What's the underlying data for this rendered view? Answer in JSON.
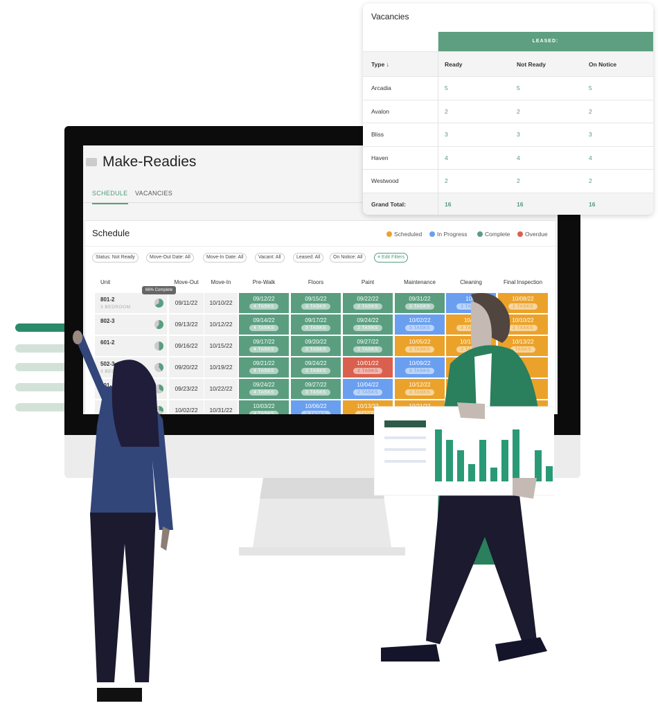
{
  "app": {
    "title": "Make-Readies",
    "tabs": [
      "SCHEDULE",
      "VACANCIES"
    ],
    "active_tab": "SCHEDULE"
  },
  "schedule": {
    "title": "Schedule",
    "legend": [
      {
        "label": "Scheduled",
        "color": "#eba22a"
      },
      {
        "label": "In Progress",
        "color": "#6a9ff0"
      },
      {
        "label": "Complete",
        "color": "#5a9e7f"
      },
      {
        "label": "Overdue",
        "color": "#d9604e"
      }
    ],
    "filters": [
      "Status: Not Ready",
      "Move-Out Date: All",
      "Move-In Date: All",
      "Vacant: All",
      "Leased: All",
      "On Notice: All"
    ],
    "edit_filters": "Edit Filters",
    "columns": [
      "Unit",
      "Move-Out",
      "Move-In",
      "Pre-Walk",
      "Floors",
      "Paint",
      "Maintenance",
      "Cleaning",
      "Final Inspection"
    ],
    "tooltip": "66% Complete",
    "rows": [
      {
        "unit": "801-2",
        "type": "3 BEDROOM",
        "out": "09/11/22",
        "in": "10/10/22",
        "cells": [
          [
            "09/12/22",
            "4 TASKS",
            "complete"
          ],
          [
            "09/15/22",
            "3 TASKS",
            "complete"
          ],
          [
            "09/22/22",
            "2 TASKS",
            "complete"
          ],
          [
            "09/31/22",
            "3 TASKS",
            "complete"
          ],
          [
            "10/0",
            "3 TASKS",
            "progress"
          ],
          [
            "10/08/22",
            "2 TASKS",
            "scheduled"
          ]
        ]
      },
      {
        "unit": "802-3",
        "type": "",
        "out": "09/13/22",
        "in": "10/12/22",
        "cells": [
          [
            "09/14/22",
            "4 TASKS",
            "complete"
          ],
          [
            "09/17/22",
            "3 TASKS",
            "complete"
          ],
          [
            "09/24/22",
            "2 TASKS",
            "complete"
          ],
          [
            "10/02/22",
            "3 TASKS",
            "progress"
          ],
          [
            "10/07",
            "3 TASKS",
            "scheduled"
          ],
          [
            "10/10/22",
            "2 TASKS",
            "scheduled"
          ]
        ]
      },
      {
        "unit": "601-2",
        "type": "",
        "out": "09/16/22",
        "in": "10/15/22",
        "cells": [
          [
            "09/17/22",
            "4 TASKS",
            "complete"
          ],
          [
            "09/20/22",
            "3 TASKS",
            "complete"
          ],
          [
            "09/27/22",
            "2 TASKS",
            "complete"
          ],
          [
            "10/05/22",
            "3 TASKS",
            "scheduled"
          ],
          [
            "10/10/22",
            "3 TASKS",
            "scheduled"
          ],
          [
            "10/13/22",
            "TASKS",
            "scheduled"
          ]
        ]
      },
      {
        "unit": "502-3",
        "type": "3 BEDROOM",
        "out": "09/20/22",
        "in": "10/19/22",
        "cells": [
          [
            "09/21/22",
            "4 TASKS",
            "complete"
          ],
          [
            "09/24/22",
            "3 TASKS",
            "complete"
          ],
          [
            "10/01/22",
            "2 TASKS",
            "overdue"
          ],
          [
            "10/09/22",
            "3 TASKS",
            "progress"
          ],
          [
            "",
            "",
            "scheduled"
          ],
          [
            "",
            "",
            "scheduled"
          ]
        ]
      },
      {
        "unit": "801-",
        "type": "STUDIO",
        "out": "09/23/22",
        "in": "10/22/22",
        "cells": [
          [
            "09/24/22",
            "4 TASKS",
            "complete"
          ],
          [
            "09/27/22",
            "3 TASKS",
            "complete"
          ],
          [
            "10/04/22",
            "2 TASKS",
            "progress"
          ],
          [
            "10/12/22",
            "3 TASKS",
            "scheduled"
          ],
          [
            "",
            "",
            "scheduled"
          ],
          [
            "",
            "",
            "scheduled"
          ]
        ]
      },
      {
        "unit": "",
        "type": "",
        "out": "10/02/22",
        "in": "10/31/22",
        "cells": [
          [
            "10/03/22",
            "4 TASKS",
            "complete"
          ],
          [
            "10/06/22",
            "3 TASKS",
            "progress"
          ],
          [
            "10/13/22",
            "TASKS",
            "scheduled"
          ],
          [
            "10/21/22",
            "",
            "scheduled"
          ],
          [
            "",
            "",
            "scheduled"
          ],
          [
            "",
            "",
            "scheduled"
          ]
        ]
      }
    ],
    "progress": [
      0.66,
      0.6,
      0.5,
      0.4,
      0.35,
      0.3
    ]
  },
  "vacancies": {
    "title": "Vacancies",
    "group": "LEASED:",
    "headers": [
      "Type ↓",
      "Ready",
      "Not Ready",
      "On Notice"
    ],
    "rows": [
      [
        "Arcadia",
        "5",
        "5",
        "5"
      ],
      [
        "Avalon",
        "2",
        "2",
        "2"
      ],
      [
        "Bliss",
        "3",
        "3",
        "3"
      ],
      [
        "Haven",
        "4",
        "4",
        "4"
      ],
      [
        "Westwood",
        "2",
        "2",
        "2"
      ]
    ],
    "total": [
      "Grand Total:",
      "16",
      "16",
      "16"
    ]
  },
  "colors": {
    "complete": "#5a9e7f",
    "progress": "#6a9ff0",
    "scheduled": "#eba22a",
    "overdue": "#d9604e"
  }
}
